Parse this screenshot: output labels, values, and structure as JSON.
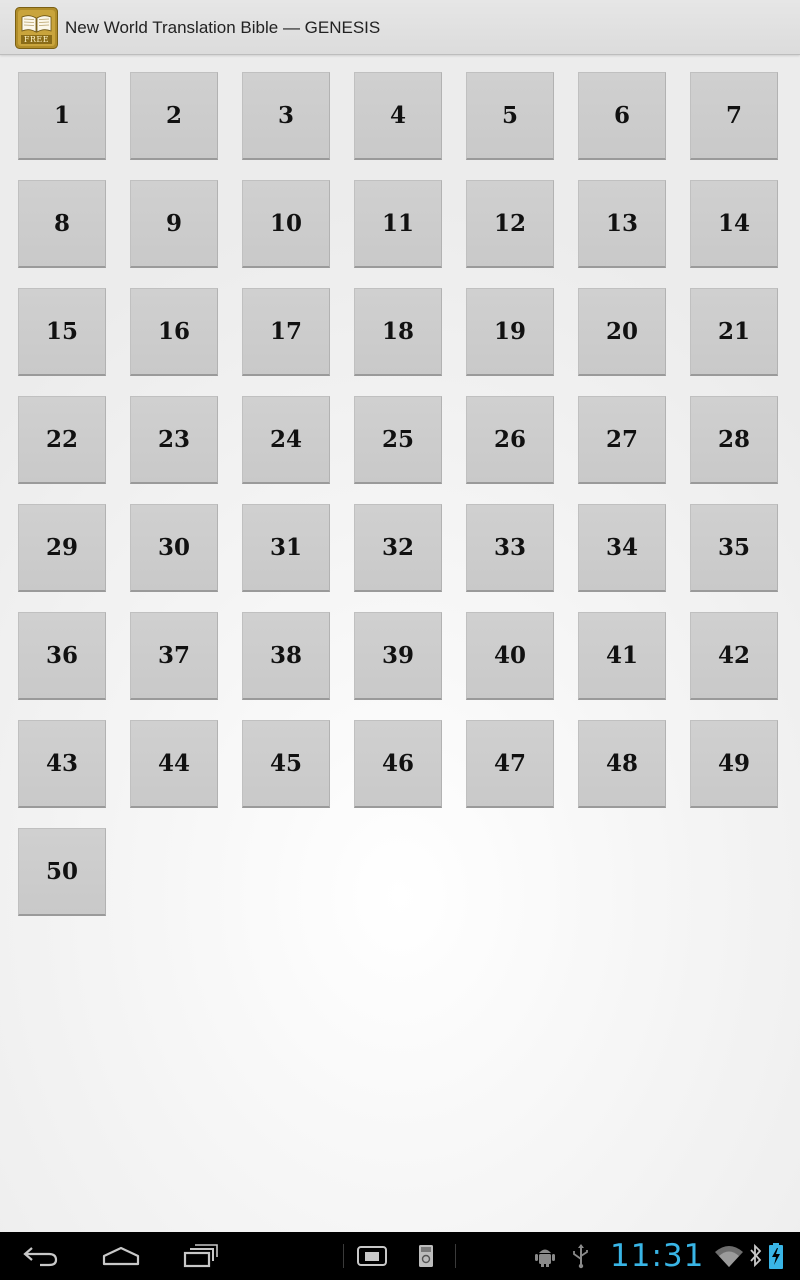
{
  "action_bar": {
    "title": "New World Translation Bible — GENESIS",
    "app_icon": {
      "name": "bible-book-icon",
      "badge_text": "FREE"
    }
  },
  "chapters": [
    "1",
    "2",
    "3",
    "4",
    "5",
    "6",
    "7",
    "8",
    "9",
    "10",
    "11",
    "12",
    "13",
    "14",
    "15",
    "16",
    "17",
    "18",
    "19",
    "20",
    "21",
    "22",
    "23",
    "24",
    "25",
    "26",
    "27",
    "28",
    "29",
    "30",
    "31",
    "32",
    "33",
    "34",
    "35",
    "36",
    "37",
    "38",
    "39",
    "40",
    "41",
    "42",
    "43",
    "44",
    "45",
    "46",
    "47",
    "48",
    "49",
    "50"
  ],
  "system_bar": {
    "nav_icons": [
      "back-icon",
      "home-icon",
      "recent-apps-icon",
      "screenshot-icon",
      "sd-card-icon"
    ],
    "status_icons": [
      "android-debug-icon",
      "usb-icon",
      "wifi-icon",
      "bluetooth-icon",
      "battery-icon"
    ],
    "clock": "11:31",
    "accent_color": "#39b5e6"
  }
}
